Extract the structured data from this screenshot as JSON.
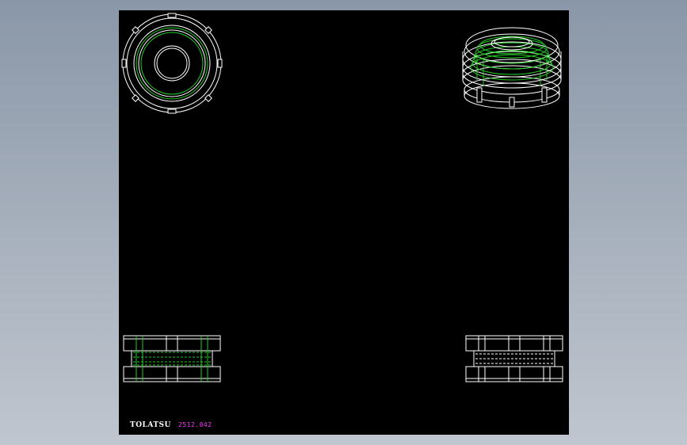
{
  "drawing": {
    "brand_text": "TOLATSU",
    "part_code": "2512.042"
  },
  "colors": {
    "background": "#000000",
    "outline": "#ffffff",
    "hatch": "#22cc22",
    "code_text": "#ff33ff",
    "app_backdrop": "#a3adba"
  },
  "views": [
    {
      "name": "top-view",
      "kind": "plan"
    },
    {
      "name": "isometric-view",
      "kind": "isometric"
    },
    {
      "name": "front-view-left",
      "kind": "elevation"
    },
    {
      "name": "front-view-right",
      "kind": "elevation"
    }
  ]
}
